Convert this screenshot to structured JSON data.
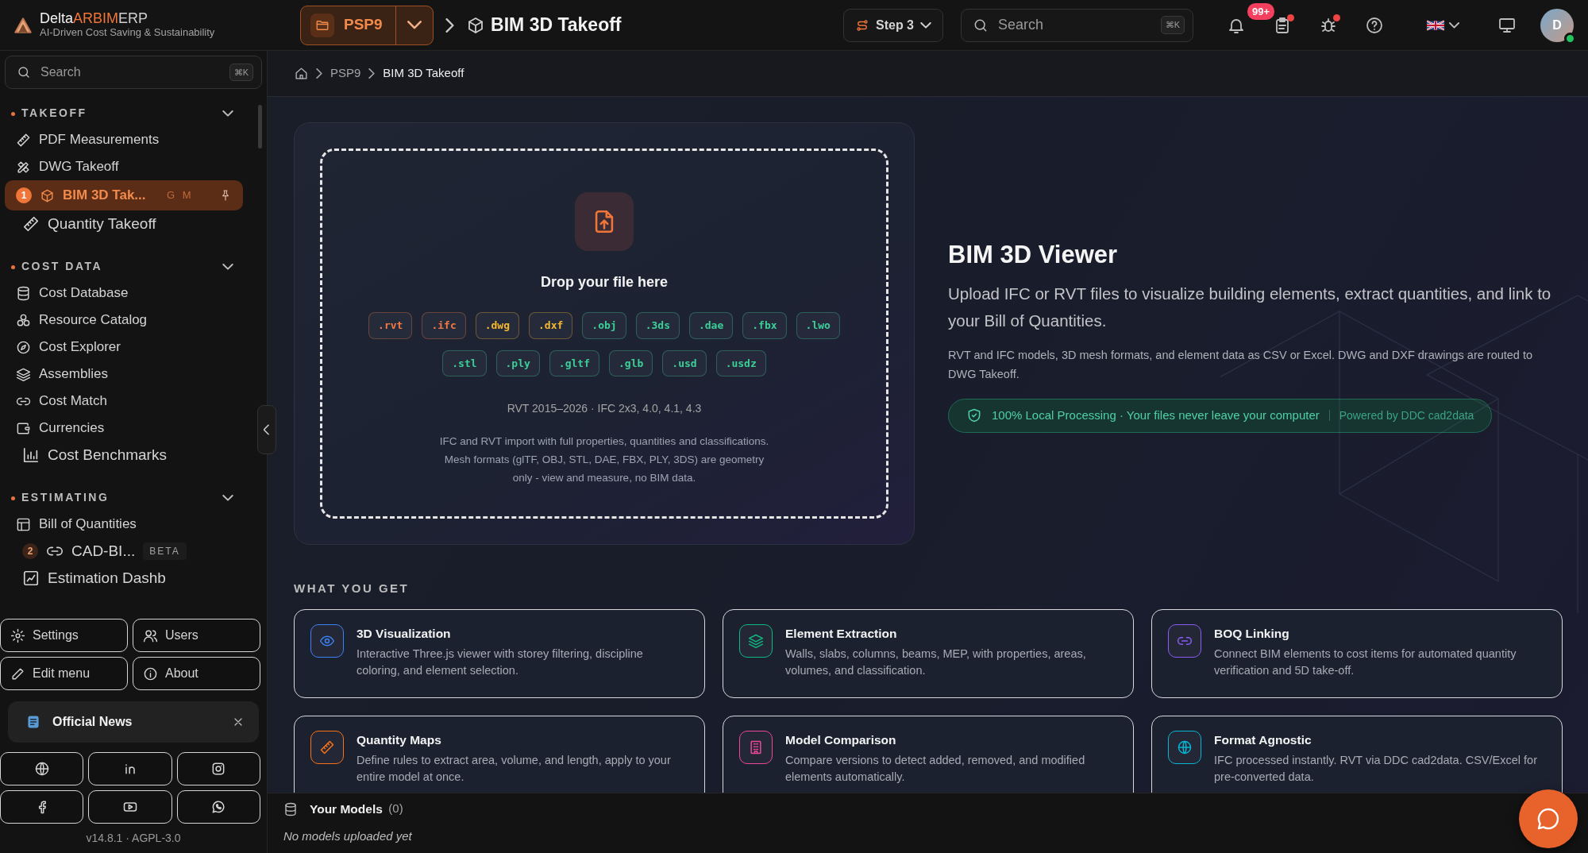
{
  "topbar": {
    "brand": {
      "name_parts": [
        "Delta",
        "ARBIM",
        "ERP"
      ],
      "tagline": "AI-Driven Cost Saving & Sustainability"
    },
    "project": "PSP9",
    "page_title": "BIM 3D Takeoff",
    "step": "Step 3",
    "search": {
      "placeholder": "Search",
      "shortcut": "⌘K"
    },
    "notifications": "99+",
    "avatar": "D"
  },
  "breadcrumb": [
    "PSP9",
    "BIM 3D Takeoff"
  ],
  "sidebar": {
    "search": {
      "placeholder": "Search",
      "shortcut": "⌘K"
    },
    "sections": [
      {
        "title": "TAKEOFF",
        "expanded": true,
        "items": [
          {
            "label": "PDF Measurements",
            "selected": false,
            "kind": "normal"
          },
          {
            "label": "DWG Takeoff",
            "selected": false,
            "kind": "normal"
          },
          {
            "label": "BIM 3D Tak...",
            "selected": true,
            "kind": "normal",
            "number": "1",
            "shortcut": "G M",
            "pinned": true
          },
          {
            "label": "Quantity Takeoff",
            "selected": false,
            "kind": "large"
          }
        ]
      },
      {
        "title": "COST DATA",
        "expanded": true,
        "items": [
          {
            "label": "Cost Database",
            "selected": false,
            "kind": "normal"
          },
          {
            "label": "Resource Catalog",
            "selected": false,
            "kind": "normal"
          },
          {
            "label": "Cost Explorer",
            "selected": false,
            "kind": "normal"
          },
          {
            "label": "Assemblies",
            "selected": false,
            "kind": "normal"
          },
          {
            "label": "Cost Match",
            "selected": false,
            "kind": "normal"
          },
          {
            "label": "Currencies",
            "selected": false,
            "kind": "normal"
          },
          {
            "label": "Cost Benchmarks",
            "selected": false,
            "kind": "large"
          }
        ]
      },
      {
        "title": "ESTIMATING",
        "expanded": true,
        "items": [
          {
            "label": "Bill of Quantities",
            "selected": false,
            "kind": "normal"
          },
          {
            "label": "CAD-BI...",
            "selected": false,
            "kind": "large",
            "number": "2",
            "tag": "BETA"
          },
          {
            "label": "Estimation Dashb",
            "selected": false,
            "kind": "large"
          }
        ]
      }
    ],
    "buttons": [
      "Settings",
      "Users",
      "Edit menu",
      "About"
    ],
    "news": {
      "title": "Official News"
    },
    "version": "v14.8.1 · AGPL-3.0"
  },
  "upload": {
    "title": "Drop your file here",
    "format_rows": [
      [
        {
          "label": ".rvt",
          "color": "#ef7a45"
        },
        {
          "label": ".ifc",
          "color": "#ef7a45"
        },
        {
          "label": ".dwg",
          "color": "#f5b82e"
        },
        {
          "label": ".dxf",
          "color": "#f5b82e"
        },
        {
          "label": ".obj",
          "color": "#3ccf98"
        },
        {
          "label": ".3ds",
          "color": "#3ccf98"
        },
        {
          "label": ".dae",
          "color": "#3ccf98"
        },
        {
          "label": ".fbx",
          "color": "#3ccf98"
        },
        {
          "label": ".lwo",
          "color": "#3ccf98"
        }
      ],
      [
        {
          "label": ".stl",
          "color": "#3ccf98"
        },
        {
          "label": ".ply",
          "color": "#3ccf98"
        },
        {
          "label": ".gltf",
          "color": "#3ccf98"
        },
        {
          "label": ".glb",
          "color": "#3ccf98"
        },
        {
          "label": ".usd",
          "color": "#3ccf98"
        },
        {
          "label": ".usdz",
          "color": "#3ccf98"
        }
      ]
    ],
    "versions": "RVT 2015–2026 · IFC 2x3, 4.0, 4.1, 4.3",
    "description": "IFC and RVT import with full properties, quantities and classifications. Mesh formats (glTF, OBJ, STL, DAE, FBX, PLY, 3DS) are geometry only - view and measure, no BIM data."
  },
  "hero": {
    "title": "BIM 3D Viewer",
    "lead": "Upload IFC or RVT files to visualize building elements, extract quantities, and link to your Bill of Quantities.",
    "note": "RVT and IFC models, 3D mesh formats, and element data as CSV or Excel. DWG and DXF drawings are routed to DWG Takeoff.",
    "badge": "100% Local Processing · Your files never leave your computer",
    "powered": "Powered by DDC cad2data"
  },
  "features": {
    "title": "WHAT YOU GET",
    "items": [
      {
        "title": "3D Visualization",
        "text": "Interactive Three.js viewer with storey filtering, discipline coloring, and element selection.",
        "color": "#3b82f6"
      },
      {
        "title": "Element Extraction",
        "text": "Walls, slabs, columns, beams, MEP, with properties, areas, volumes, and classification.",
        "color": "#10b981"
      },
      {
        "title": "BOQ Linking",
        "text": "Connect BIM elements to cost items for automated quantity verification and 5D take-off.",
        "color": "#8b5cf6"
      },
      {
        "title": "Quantity Maps",
        "text": "Define rules to extract area, volume, and length, apply to your entire model at once.",
        "color": "#f97316"
      },
      {
        "title": "Model Comparison",
        "text": "Compare versions to detect added, removed, and modified elements automatically.",
        "color": "#ec4899"
      },
      {
        "title": "Format Agnostic",
        "text": "IFC processed instantly. RVT via DDC cad2data. CSV/Excel for pre-converted data.",
        "color": "#06b6d4"
      }
    ]
  },
  "models": {
    "title": "Your Models",
    "count": "(0)",
    "empty": "No models uploaded yet"
  }
}
